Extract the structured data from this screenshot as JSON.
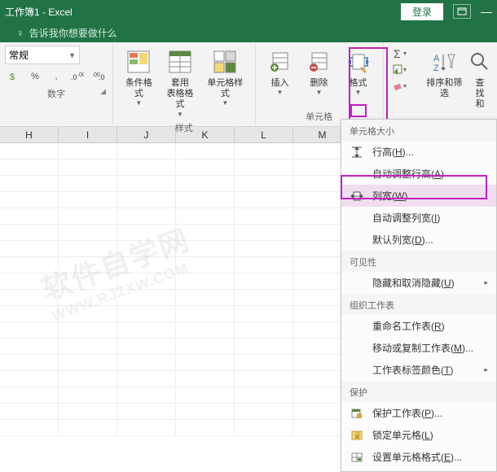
{
  "titlebar": {
    "title": "工作簿1 - Excel",
    "login": "登录"
  },
  "tellme": {
    "text": "告诉我你想要做什么"
  },
  "ribbon": {
    "number": {
      "combo": "常规",
      "group_label": "数字"
    },
    "styles": {
      "cond_fmt": "条件格式",
      "table_fmt": "套用\n表格格式",
      "cell_styles": "单元格样式",
      "group_label": "样式"
    },
    "cells": {
      "insert": "插入",
      "delete": "删除",
      "format": "格式",
      "group_label": "单元格"
    },
    "editing": {
      "sort_filter": "排序和筛选",
      "find": "查找和"
    }
  },
  "columns": [
    "H",
    "I",
    "J",
    "K",
    "L",
    "M"
  ],
  "menu": {
    "sect_size": "单元格大小",
    "row_height": "行高(H)...",
    "auto_row": "自动调整行高(A)",
    "col_width": "列宽(W)...",
    "auto_col": "自动调整列宽(I)",
    "default_width": "默认列宽(D)...",
    "sect_vis": "可见性",
    "hide_unhide": "隐藏和取消隐藏(U)",
    "sect_org": "组织工作表",
    "rename": "重命名工作表(R)",
    "move_copy": "移动或复制工作表(M)...",
    "tab_color": "工作表标签颜色(T)",
    "sect_prot": "保护",
    "protect_sheet": "保护工作表(P)...",
    "lock_cell": "锁定单元格(L)",
    "format_cells": "设置单元格格式(E)..."
  },
  "watermark": {
    "line1": "软件自学网",
    "line2": "WWW.RJZXW.COM"
  }
}
